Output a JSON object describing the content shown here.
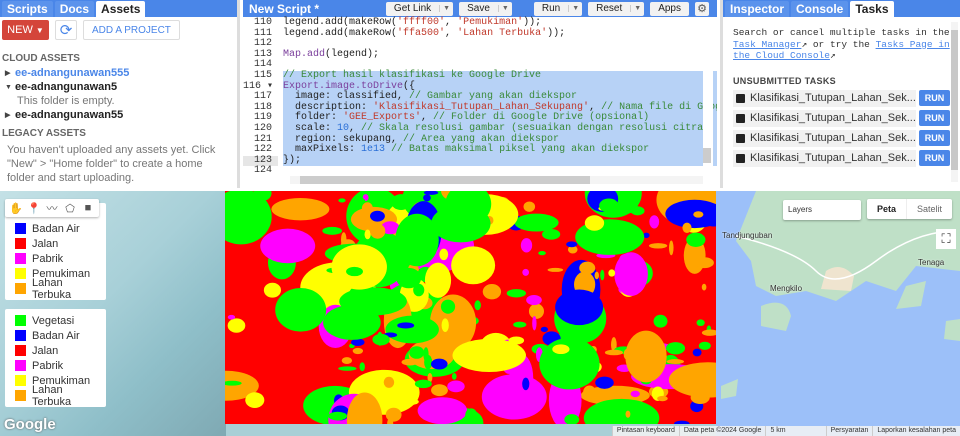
{
  "left_panel": {
    "tabs": [
      "Scripts",
      "Docs",
      "Assets"
    ],
    "active_tab": "Assets",
    "new_label": "NEW",
    "refresh_icon": "refresh-icon",
    "add_project_label": "ADD A PROJECT",
    "cloud_assets_heading": "CLOUD ASSETS",
    "projects": [
      {
        "name": "ee-adnangunawan555",
        "expanded": false
      },
      {
        "name": "ee-adnangunawan5",
        "expanded": true,
        "note": "This folder is empty."
      },
      {
        "name": "ee-adnangunawan55",
        "expanded": false
      }
    ],
    "legacy_heading": "LEGACY ASSETS",
    "legacy_message": "You haven't uploaded any assets yet. Click \"New\" > \"Home folder\" to create a home folder and start uploading."
  },
  "editor": {
    "title": "New Script *",
    "buttons": {
      "get_link": "Get Link",
      "save": "Save",
      "run": "Run",
      "reset": "Reset",
      "apps": "Apps"
    },
    "lines": [
      {
        "n": "110",
        "tokens": [
          [
            "p",
            "legend.add(makeRow("
          ],
          [
            "s",
            "'ffff00'"
          ],
          [
            "p",
            ", "
          ],
          [
            "s",
            "'Pemukiman'"
          ],
          [
            "p",
            "));"
          ]
        ]
      },
      {
        "n": "111",
        "tokens": [
          [
            "p",
            "legend.add(makeRow("
          ],
          [
            "s",
            "'ffa500'"
          ],
          [
            "p",
            ", "
          ],
          [
            "s",
            "'Lahan Terbuka'"
          ],
          [
            "p",
            "));"
          ]
        ]
      },
      {
        "n": "112",
        "tokens": []
      },
      {
        "n": "113",
        "tokens": [
          [
            "f",
            "Map.add"
          ],
          [
            "p",
            "(legend);"
          ]
        ]
      },
      {
        "n": "114",
        "tokens": []
      },
      {
        "n": "115",
        "sel": true,
        "tokens": [
          [
            "c",
            "// Export hasil klasifikasi ke Google Drive"
          ]
        ]
      },
      {
        "n": "116 ▾",
        "sel": true,
        "tokens": [
          [
            "f",
            "Export.image.toDrive"
          ],
          [
            "p",
            "({"
          ]
        ]
      },
      {
        "n": "117",
        "sel": true,
        "tokens": [
          [
            "p",
            "  image: classified, "
          ],
          [
            "c",
            "// Gambar yang akan diekspor"
          ]
        ]
      },
      {
        "n": "118",
        "sel": true,
        "tokens": [
          [
            "p",
            "  description: "
          ],
          [
            "s",
            "'Klasifikasi_Tutupan_Lahan_Sekupang'"
          ],
          [
            "p",
            ", "
          ],
          [
            "c",
            "// Nama file di Google Drive"
          ]
        ]
      },
      {
        "n": "119",
        "sel": true,
        "tokens": [
          [
            "p",
            "  folder: "
          ],
          [
            "s",
            "'GEE_Exports'"
          ],
          [
            "p",
            ", "
          ],
          [
            "c",
            "// Folder di Google Drive (opsional)"
          ]
        ]
      },
      {
        "n": "120",
        "sel": true,
        "tokens": [
          [
            "p",
            "  scale: "
          ],
          [
            "n",
            "10"
          ],
          [
            "p",
            ", "
          ],
          [
            "c",
            "// Skala resolusi gambar (sesuaikan dengan resolusi citra)"
          ]
        ]
      },
      {
        "n": "121",
        "sel": true,
        "tokens": [
          [
            "p",
            "  region: sekupang, "
          ],
          [
            "c",
            "// Area yang akan diekspor"
          ]
        ]
      },
      {
        "n": "122",
        "sel": true,
        "tokens": [
          [
            "p",
            "  maxPixels: "
          ],
          [
            "n",
            "1e13"
          ],
          [
            "p",
            " "
          ],
          [
            "c",
            "// Batas maksimal piksel yang akan diekspor"
          ]
        ]
      },
      {
        "n": "123",
        "sel": true,
        "cur": true,
        "tokens": [
          [
            "p",
            "});"
          ]
        ]
      },
      {
        "n": "124",
        "tokens": []
      }
    ]
  },
  "right_panel": {
    "tabs": [
      "Inspector",
      "Console",
      "Tasks"
    ],
    "active_tab": "Tasks",
    "intro_1": "Search or cancel multiple tasks in the ",
    "task_manager_link": "Task Manager",
    "intro_2": " or try the ",
    "cloud_console_link": "Tasks Page in the Cloud Console",
    "unsubmitted_heading": "UNSUBMITTED TASKS",
    "tasks": [
      {
        "name": "Klasifikasi_Tutupan_Lahan_Sek...",
        "run": "RUN"
      },
      {
        "name": "Klasifikasi_Tutupan_Lahan_Sek...",
        "run": "RUN"
      },
      {
        "name": "Klasifikasi_Tutupan_Lahan_Sek...",
        "run": "RUN"
      },
      {
        "name": "Klasifikasi_Tutupan_Lahan_Sek...",
        "run": "RUN"
      }
    ]
  },
  "map": {
    "legend_1": [
      {
        "label": "Badan Air",
        "color": "#0000ff"
      },
      {
        "label": "Jalan",
        "color": "#ff0000"
      },
      {
        "label": "Pabrik",
        "color": "#ff00ff"
      },
      {
        "label": "Pemukiman",
        "color": "#ffff00"
      },
      {
        "label": "Lahan Terbuka",
        "color": "#ffa500"
      }
    ],
    "legend_2": [
      {
        "label": "Vegetasi",
        "color": "#00ff00"
      },
      {
        "label": "Badan Air",
        "color": "#0000ff"
      },
      {
        "label": "Jalan",
        "color": "#ff0000"
      },
      {
        "label": "Pabrik",
        "color": "#ff00ff"
      },
      {
        "label": "Pemukiman",
        "color": "#ffff00"
      },
      {
        "label": "Lahan Terbuka",
        "color": "#ffa500"
      }
    ],
    "layers_label": "Layers",
    "map_type": [
      "Peta",
      "Satelit"
    ],
    "places": [
      "Tandjunguban",
      "Mengkilo",
      "Tenaga"
    ],
    "google_logo": "Google",
    "attribution": [
      "Pintasan keyboard",
      "Data peta ©2024 Google",
      "5 km",
      "Persyaratan",
      "Laporkan kesalahan peta"
    ]
  }
}
